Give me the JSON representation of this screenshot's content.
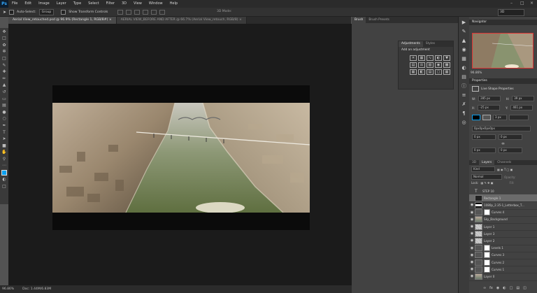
{
  "app": {
    "logo": "Ps"
  },
  "menu": [
    "File",
    "Edit",
    "Image",
    "Layer",
    "Type",
    "Select",
    "Filter",
    "3D",
    "View",
    "Window",
    "Help"
  ],
  "options": {
    "auto_select_label": "Auto-Select:",
    "auto_select_value": "Group",
    "transform_label": "Show Transform Controls",
    "mode_3d": "3D Mode:",
    "workspace": "3D"
  },
  "tabs": [
    "Aerial View_retouched.psd @ 96.9% (Rectangle 1, RGB/8#) ×",
    "AERIAL VIEW_BEFORE AND AFTER @ 66.7% (Aerial View_retouch, RGB/8) ×"
  ],
  "status": {
    "zoom": "96.86%",
    "doc": "Doc: 1.44M/6.83M"
  },
  "mid_panel": {
    "tabs": [
      "Brush",
      "Brush Presets"
    ],
    "adjust_tabs": [
      "Adjustments",
      "Styles"
    ],
    "adjust_hint": "Add an adjustment"
  },
  "navigator": {
    "title": "Navigator",
    "zoom": "96.86%"
  },
  "properties": {
    "title": "Properties",
    "subtitle": "Live Shape Properties",
    "w_label": "W:",
    "w": "285 px",
    "h_label": "H:",
    "h": "39 px",
    "x_label": "X:",
    "x": "-25 px",
    "y_label": "Y:",
    "y": "461 px",
    "stroke_width": "3 px",
    "corners": "0px0px0px0px",
    "c1": "0 px",
    "c2": "0 px",
    "c3": "0 px",
    "c4": "0 px"
  },
  "layers_panel": {
    "tabs": [
      "3D",
      "Layers",
      "Channels"
    ],
    "filter": "Kind",
    "blend": "Normal",
    "opacity_label": "Opacity:",
    "lock_label": "Lock:",
    "fill_label": "Fill:",
    "layers": [
      {
        "name": "STEP 10",
        "kind": "text",
        "visible": false
      },
      {
        "name": "Rectangle 1",
        "kind": "shape",
        "visible": false,
        "selected": true
      },
      {
        "name": "1080p_2.35-1_Letterbox_T...",
        "kind": "image",
        "visible": true
      },
      {
        "name": "Curves 4",
        "kind": "adjust",
        "visible": true
      },
      {
        "name": "Sky_Background",
        "kind": "image",
        "visible": true
      },
      {
        "name": "Layer 1",
        "kind": "checker",
        "visible": true
      },
      {
        "name": "Layer 3",
        "kind": "checker",
        "visible": true
      },
      {
        "name": "Layer 2",
        "kind": "checker",
        "visible": true
      },
      {
        "name": "Levels 1",
        "kind": "adjust",
        "visible": true
      },
      {
        "name": "Curves 3",
        "kind": "adjust",
        "visible": true
      },
      {
        "name": "Curves 2",
        "kind": "adjust",
        "visible": true
      },
      {
        "name": "Curves 1",
        "kind": "adjust",
        "visible": true
      },
      {
        "name": "Layer 0",
        "kind": "image",
        "visible": true
      }
    ]
  },
  "colors": {
    "foreground": "#0aa0f0",
    "nav_border": "#dd3333"
  }
}
